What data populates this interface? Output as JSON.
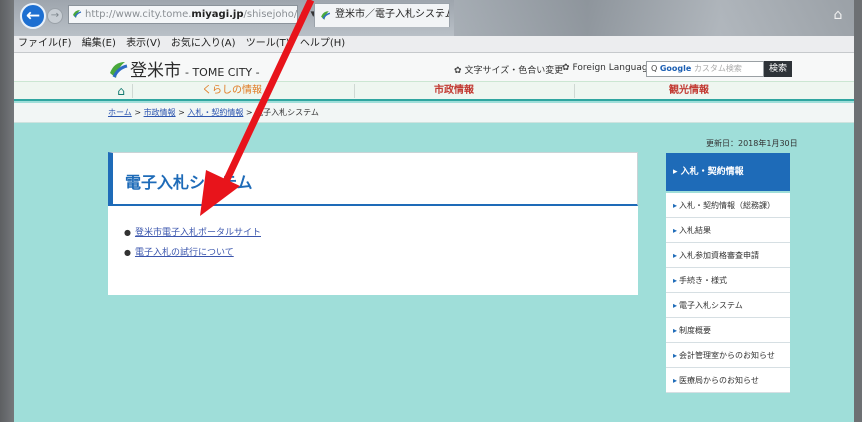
{
  "browser": {
    "url_prefix": "http://www.city.tome.",
    "url_domain": "miyagi.jp",
    "url_suffix": "/shisejoho/",
    "address_controls": "ρ ▾",
    "tab_title": "登米市／電子入札システム",
    "tab_close": "×",
    "menu": [
      "ファイル(F)",
      "編集(E)",
      "表示(V)",
      "お気に入り(A)",
      "ツール(T)",
      "ヘルプ(H)"
    ]
  },
  "site": {
    "logo_text": "登米市",
    "logo_sub": "- TOME CITY -",
    "util_text_size": "文字サイズ・色合い変更",
    "util_language": "Foreign Language",
    "search_label": "Google",
    "search_placeholder": "カスタム検索",
    "search_button": "検索",
    "global_nav": [
      "くらしの情報",
      "市政情報",
      "観光情報"
    ],
    "breadcrumb": {
      "home": "ホーム",
      "sep": ">",
      "level1": "市政情報",
      "level2": "入札・契約情報",
      "current": "電子入札システム"
    },
    "updated": "更新日：2018年1月30日",
    "page_title": "電子入札システム",
    "links": [
      "登米市電子入札ポータルサイト",
      "電子入札の試行について"
    ],
    "sidebar": {
      "head": "入札・契約情報",
      "items": [
        "入札・契約情報（総務課）",
        "入札結果",
        "入札参加資格審査申請",
        "手続き・様式",
        "電子入札システム",
        "制度概要",
        "会計管理室からのお知らせ",
        "医療局からのお知らせ"
      ]
    }
  },
  "colors": {
    "accent": "#1e6bb8",
    "page_bg": "#9fded9",
    "annotation": "#e8141b"
  }
}
